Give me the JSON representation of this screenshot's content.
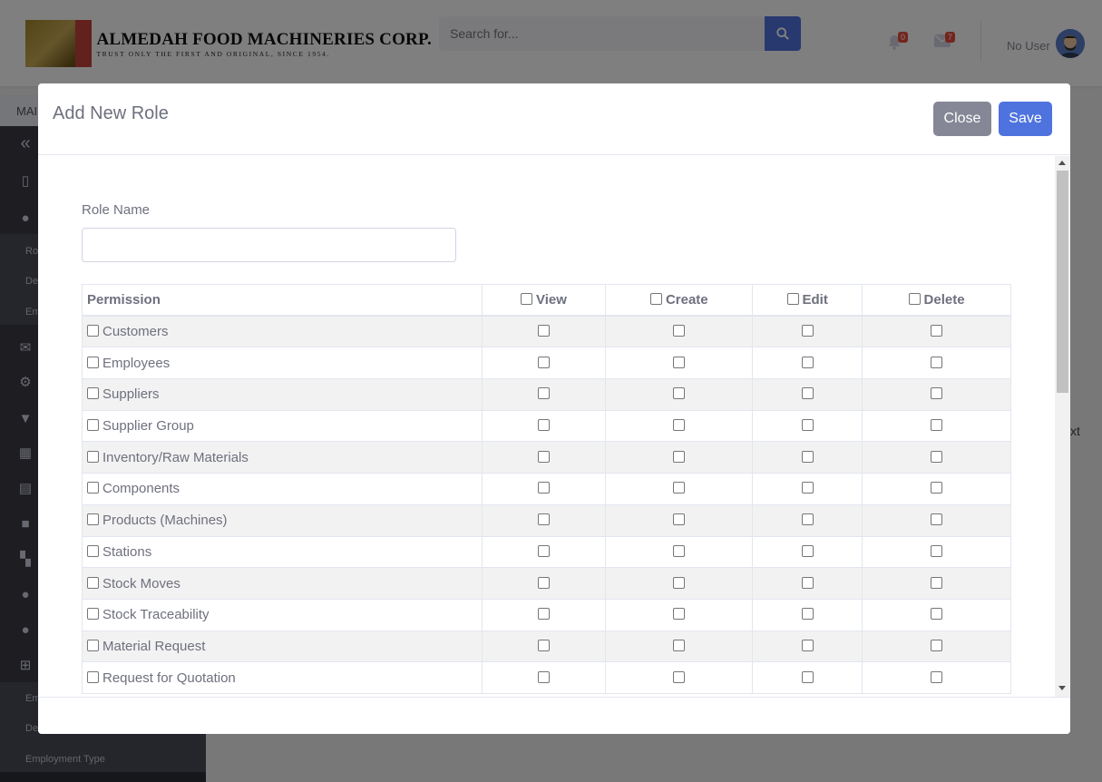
{
  "header": {
    "company_name": "ALMEDAH FOOD MACHINERIES CORP.",
    "tagline": "TRUST ONLY THE FIRST AND ORIGINAL, SINCE 1954.",
    "search_placeholder": "Search for...",
    "alerts_count": "0",
    "messages_count": "7",
    "user_name": "No User"
  },
  "sidebar": {
    "breadcrumb": "MAI",
    "sub_items_top": [
      "Ro",
      "De",
      "Em"
    ],
    "sub_items_bottom": [
      "Em",
      "De",
      "Employment Type"
    ]
  },
  "background": {
    "next_fragment": "xt"
  },
  "modal": {
    "title": "Add New Role",
    "close_label": "Close",
    "save_label": "Save",
    "role_name_label": "Role Name",
    "role_name_value": "",
    "table": {
      "headers": [
        "Permission",
        "View",
        "Create",
        "Edit",
        "Delete"
      ],
      "rows": [
        "Customers",
        "Employees",
        "Suppliers",
        "Supplier Group",
        "Inventory/Raw Materials",
        "Components",
        "Products (Machines)",
        "Stations",
        "Stock Moves",
        "Stock Traceability",
        "Material Request",
        "Request for Quotation"
      ]
    }
  },
  "colors": {
    "primary": "#4e73df",
    "secondary": "#858796",
    "sidebar": "#3a3b45",
    "badge": "#e74a3b"
  }
}
